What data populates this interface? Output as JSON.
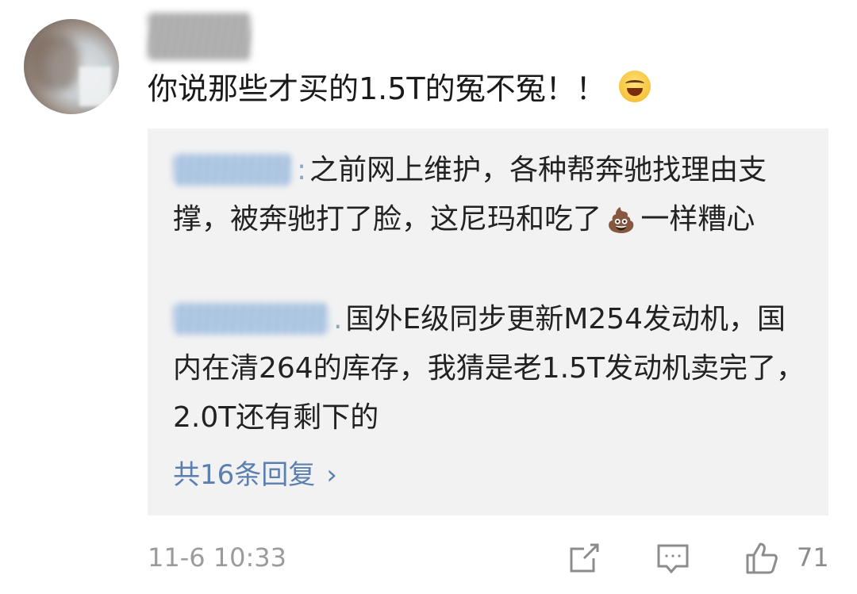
{
  "comment": {
    "text": "你说那些才买的1.5T的冤不冤！！",
    "emoji": "laughing-crying-emoji",
    "timestamp": "11-6 10:33",
    "like_count": "71"
  },
  "replies": [
    {
      "text": "之前网上维护，各种帮奔驰找理由支撑，被奔驰打了脸，这尼玛和吃了",
      "emoji": "💩",
      "text_after": "一样糟心"
    },
    {
      "text": "国外E级同步更新M254发动机，国内在清264的库存，我猜是老1.5T发动机卖完了，2.0T还有剩下的"
    }
  ],
  "more_replies": {
    "label": "共16条回复",
    "chevron": "›"
  },
  "icons": {
    "share": "share-icon",
    "comment": "comment-icon",
    "like": "thumbs-up-icon"
  },
  "colors": {
    "reply_background": "#f2f2f2",
    "link_blue": "#5a7fb0",
    "meta_gray": "#9b9b9b"
  }
}
